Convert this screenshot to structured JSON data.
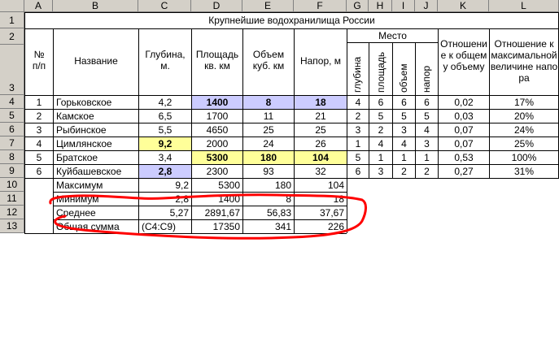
{
  "columns": [
    "A",
    "B",
    "C",
    "D",
    "E",
    "F",
    "G",
    "H",
    "I",
    "J",
    "K",
    "L"
  ],
  "rows": [
    "1",
    "2",
    "3",
    "4",
    "5",
    "6",
    "7",
    "8",
    "9",
    "10",
    "11",
    "12",
    "13"
  ],
  "title": "Крупнейшие водохранилища России",
  "headers": {
    "num": "№ п/п",
    "name": "Название",
    "depth": "Глубина, м.",
    "area": "Площадь кв. км",
    "volume": "Объем куб. км",
    "head": "Напор, м",
    "place": "Место",
    "place_depth": "глубина",
    "place_area": "площадь",
    "place_volume": "объем",
    "place_head": "напор",
    "ratio_total": "Отношение к общему объему",
    "ratio_max": "Отношение к максимальной величине напора"
  },
  "table": [
    [
      "1",
      "Горьковское",
      "4,2",
      "1400",
      "8",
      "18",
      "4",
      "6",
      "6",
      "6",
      "0,02",
      "17%"
    ],
    [
      "2",
      "Камское",
      "6,5",
      "1700",
      "11",
      "21",
      "2",
      "5",
      "5",
      "5",
      "0,03",
      "20%"
    ],
    [
      "3",
      "Рыбинское",
      "5,5",
      "4650",
      "25",
      "25",
      "3",
      "2",
      "3",
      "4",
      "0,07",
      "24%"
    ],
    [
      "4",
      "Цимлянское",
      "9,2",
      "2000",
      "24",
      "26",
      "1",
      "4",
      "4",
      "3",
      "0,07",
      "25%"
    ],
    [
      "5",
      "Братское",
      "3,4",
      "5300",
      "180",
      "104",
      "5",
      "1",
      "1",
      "1",
      "0,53",
      "100%"
    ],
    [
      "6",
      "Куйбашевское",
      "2,8",
      "2300",
      "93",
      "32",
      "6",
      "3",
      "2",
      "2",
      "0,27",
      "31%"
    ]
  ],
  "stats": [
    [
      "Максимум",
      "9,2",
      "5300",
      "180",
      "104"
    ],
    [
      "Минимум",
      "2,8",
      "1400",
      "8",
      "18"
    ],
    [
      "Среднее",
      "5,27",
      "2891,67",
      "56,83",
      "37,67"
    ],
    [
      "Общая сумма",
      "(C4:C9)",
      "17350",
      "341",
      "226"
    ]
  ],
  "colors": {
    "highlight_min": "#ccccff",
    "highlight_max": "#ffff99",
    "annotation": "#ff0000"
  }
}
